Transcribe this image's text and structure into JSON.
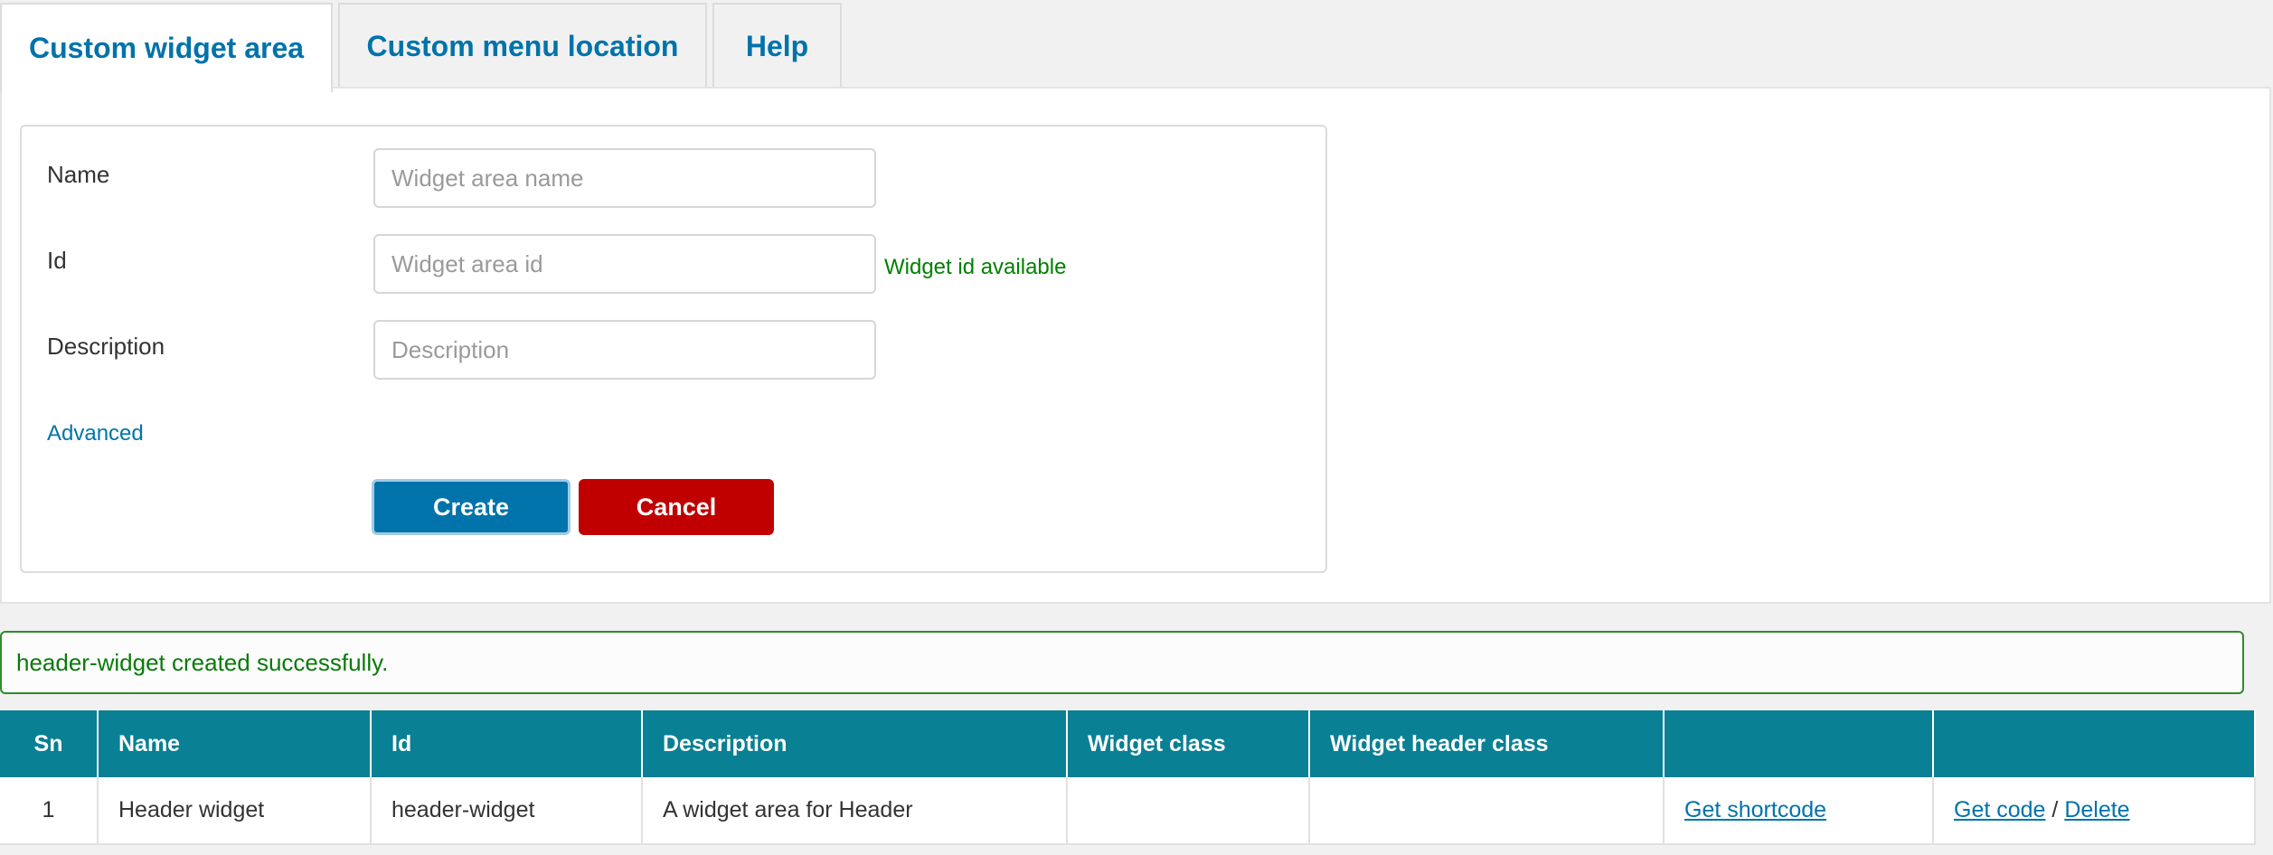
{
  "tabs": [
    {
      "label": "Custom widget area",
      "active": true
    },
    {
      "label": "Custom menu location",
      "active": false
    },
    {
      "label": "Help",
      "active": false
    }
  ],
  "form": {
    "name_label": "Name",
    "name_placeholder": "Widget area name",
    "id_label": "Id",
    "id_placeholder": "Widget area id",
    "id_status": "Widget id available",
    "description_label": "Description",
    "description_placeholder": "Description",
    "advanced_link": "Advanced",
    "create_button": "Create",
    "cancel_button": "Cancel"
  },
  "notice": "header-widget created successfully.",
  "table": {
    "headers": [
      "Sn",
      "Name",
      "Id",
      "Description",
      "Widget class",
      "Widget header class",
      "",
      ""
    ],
    "rows": [
      {
        "sn": "1",
        "name": "Header widget",
        "id": "header-widget",
        "description": "A widget area for Header",
        "widget_class": "",
        "widget_header_class": "",
        "shortcode_link": "Get shortcode",
        "code_link": "Get code",
        "separator": "/",
        "delete_link": "Delete"
      }
    ]
  },
  "colors": {
    "accent": "#0073aa",
    "table_header": "#098093",
    "success": "#008000",
    "danger": "#c00000"
  }
}
